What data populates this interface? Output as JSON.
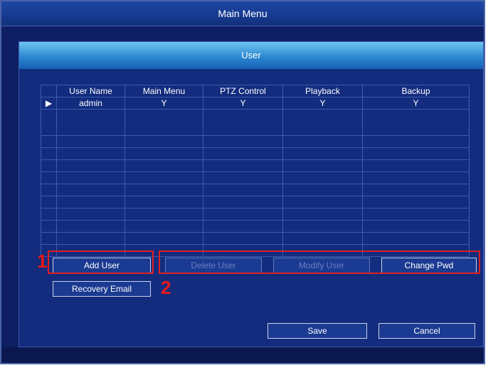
{
  "window": {
    "title": "Main Menu"
  },
  "panel": {
    "title": "User"
  },
  "table": {
    "columns": [
      "",
      "User Name",
      "Main Menu",
      "PTZ Control",
      "Playback",
      "Backup"
    ],
    "rows": [
      {
        "pointer": "▶",
        "user_name": "admin",
        "main_menu": "Y",
        "ptz_control": "Y",
        "playback": "Y",
        "backup": "Y"
      }
    ]
  },
  "buttons": {
    "add_user": "Add User",
    "delete_user": "Delete User",
    "modify_user": "Modify User",
    "change_pwd": "Change Pwd",
    "recovery_email": "Recovery Email",
    "save": "Save",
    "cancel": "Cancel"
  },
  "annotations": {
    "label1": "1",
    "label2": "2",
    "color": "#e02020"
  },
  "colors": {
    "background": "#0f1f63",
    "title_bar": "#1f46a5",
    "panel_header": "#2c89d2",
    "grid_lines": "#3b5db0"
  }
}
